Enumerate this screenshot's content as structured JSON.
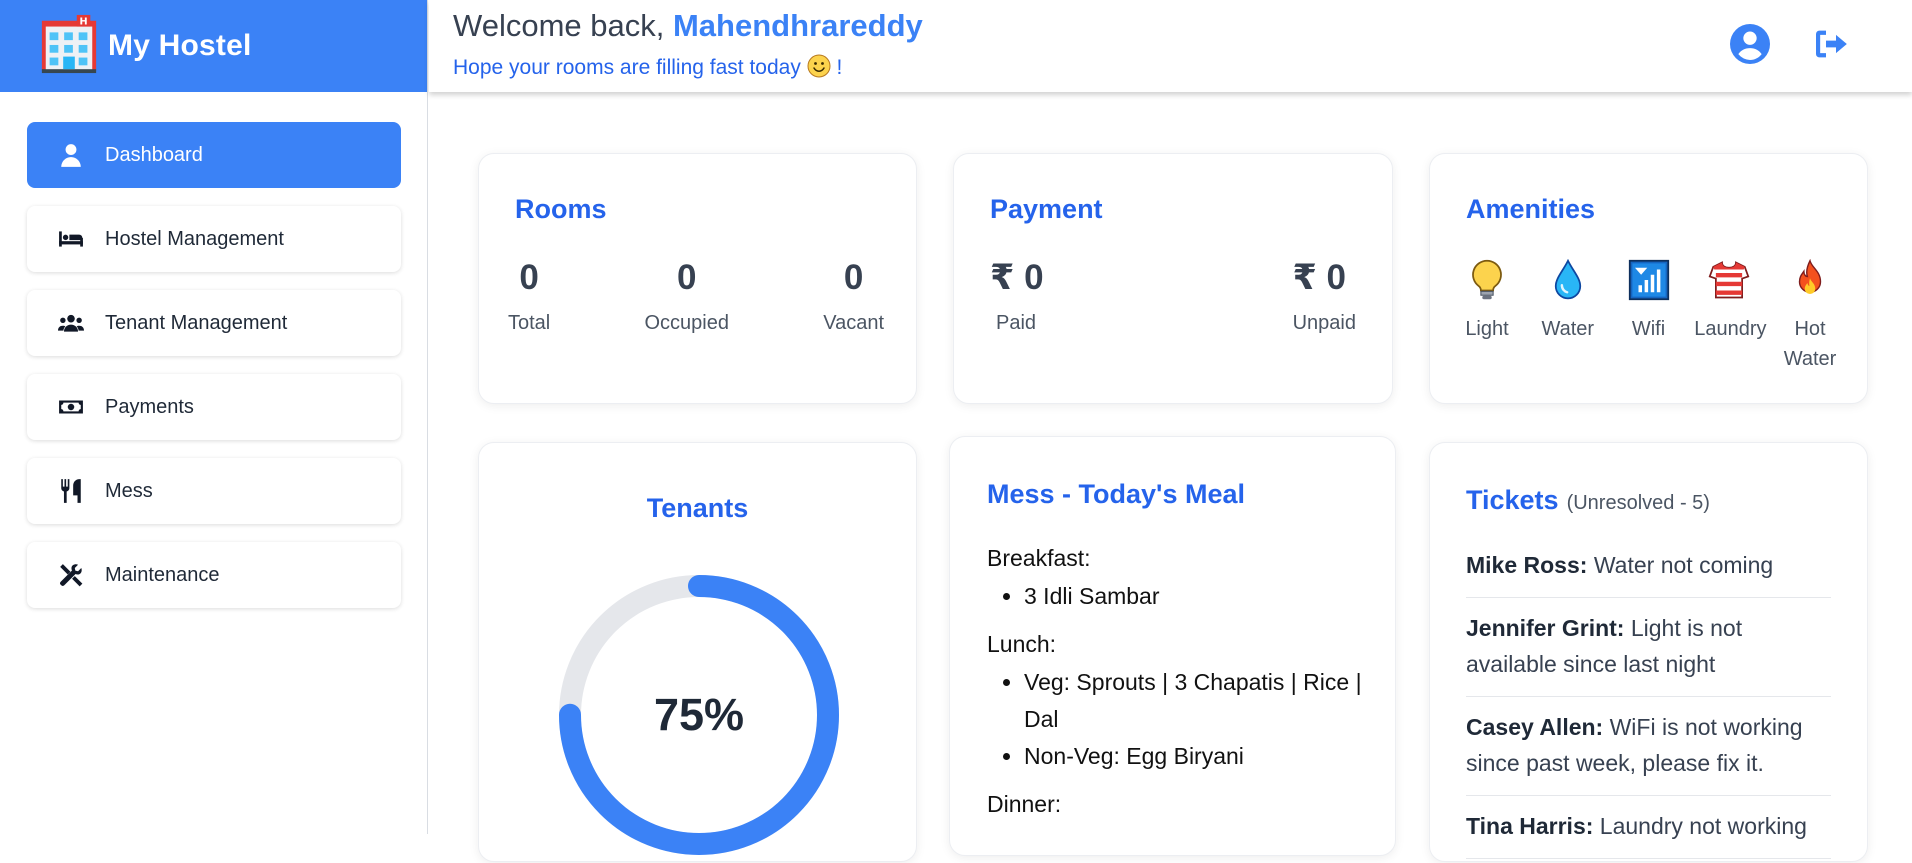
{
  "app": {
    "name": "My Hostel",
    "logo_icon": "hotel-icon"
  },
  "colors": {
    "primary": "#3b82f6",
    "title": "#2563eb",
    "ring_track": "#e5e7eb"
  },
  "sidebar": {
    "items": [
      {
        "label": "Dashboard",
        "icon": "user-icon",
        "active": true
      },
      {
        "label": "Hostel Management",
        "icon": "bed-icon",
        "active": false
      },
      {
        "label": "Tenant Management",
        "icon": "users-icon",
        "active": false
      },
      {
        "label": "Payments",
        "icon": "money-bill-icon",
        "active": false
      },
      {
        "label": "Mess",
        "icon": "utensils-icon",
        "active": false
      },
      {
        "label": "Maintenance",
        "icon": "tools-icon",
        "active": false
      }
    ]
  },
  "header": {
    "welcome_prefix": "Welcome back,",
    "username": "Mahendhrareddy",
    "subtitle": "Hope your rooms are filling fast today",
    "subtitle_suffix": "!",
    "subtitle_emoji": "smiley-icon",
    "profile_icon": "user-circle-icon",
    "logout_icon": "sign-out-icon"
  },
  "rooms": {
    "title": "Rooms",
    "stats": [
      {
        "value": "0",
        "label": "Total"
      },
      {
        "value": "0",
        "label": "Occupied"
      },
      {
        "value": "0",
        "label": "Vacant"
      }
    ]
  },
  "payment": {
    "title": "Payment",
    "paid_value": "₹ 0",
    "paid_label": "Paid",
    "unpaid_value": "₹ 0",
    "unpaid_label": "Unpaid"
  },
  "amenities": {
    "title": "Amenities",
    "items": [
      {
        "label": "Light",
        "icon": "lightbulb-icon"
      },
      {
        "label": "Water",
        "icon": "droplet-icon"
      },
      {
        "label": "Wifi",
        "icon": "signal-icon"
      },
      {
        "label": "Laundry",
        "icon": "shirt-icon"
      },
      {
        "label": "Hot Water",
        "icon": "fire-icon"
      }
    ]
  },
  "tenants": {
    "title": "Tenants",
    "percent_label": "75%",
    "percent": 75
  },
  "mess": {
    "title": "Mess - Today's Meal",
    "meals": [
      {
        "name": "Breakfast:",
        "items": [
          "3 Idli Sambar"
        ]
      },
      {
        "name": "Lunch:",
        "items": [
          "Veg: Sprouts | 3 Chapatis | Rice | Dal",
          "Non-Veg: Egg Biryani"
        ]
      },
      {
        "name": "Dinner:",
        "items": []
      }
    ]
  },
  "tickets": {
    "title": "Tickets",
    "subtitle": "(Unresolved - 5)",
    "items": [
      {
        "name": "Mike Ross:",
        "text": "Water not coming"
      },
      {
        "name": "Jennifer Grint:",
        "text": "Light is not available since last night"
      },
      {
        "name": "Casey Allen:",
        "text": "WiFi is not working since past week, please fix it."
      },
      {
        "name": "Tina Harris:",
        "text": "Laundry not working"
      }
    ]
  }
}
